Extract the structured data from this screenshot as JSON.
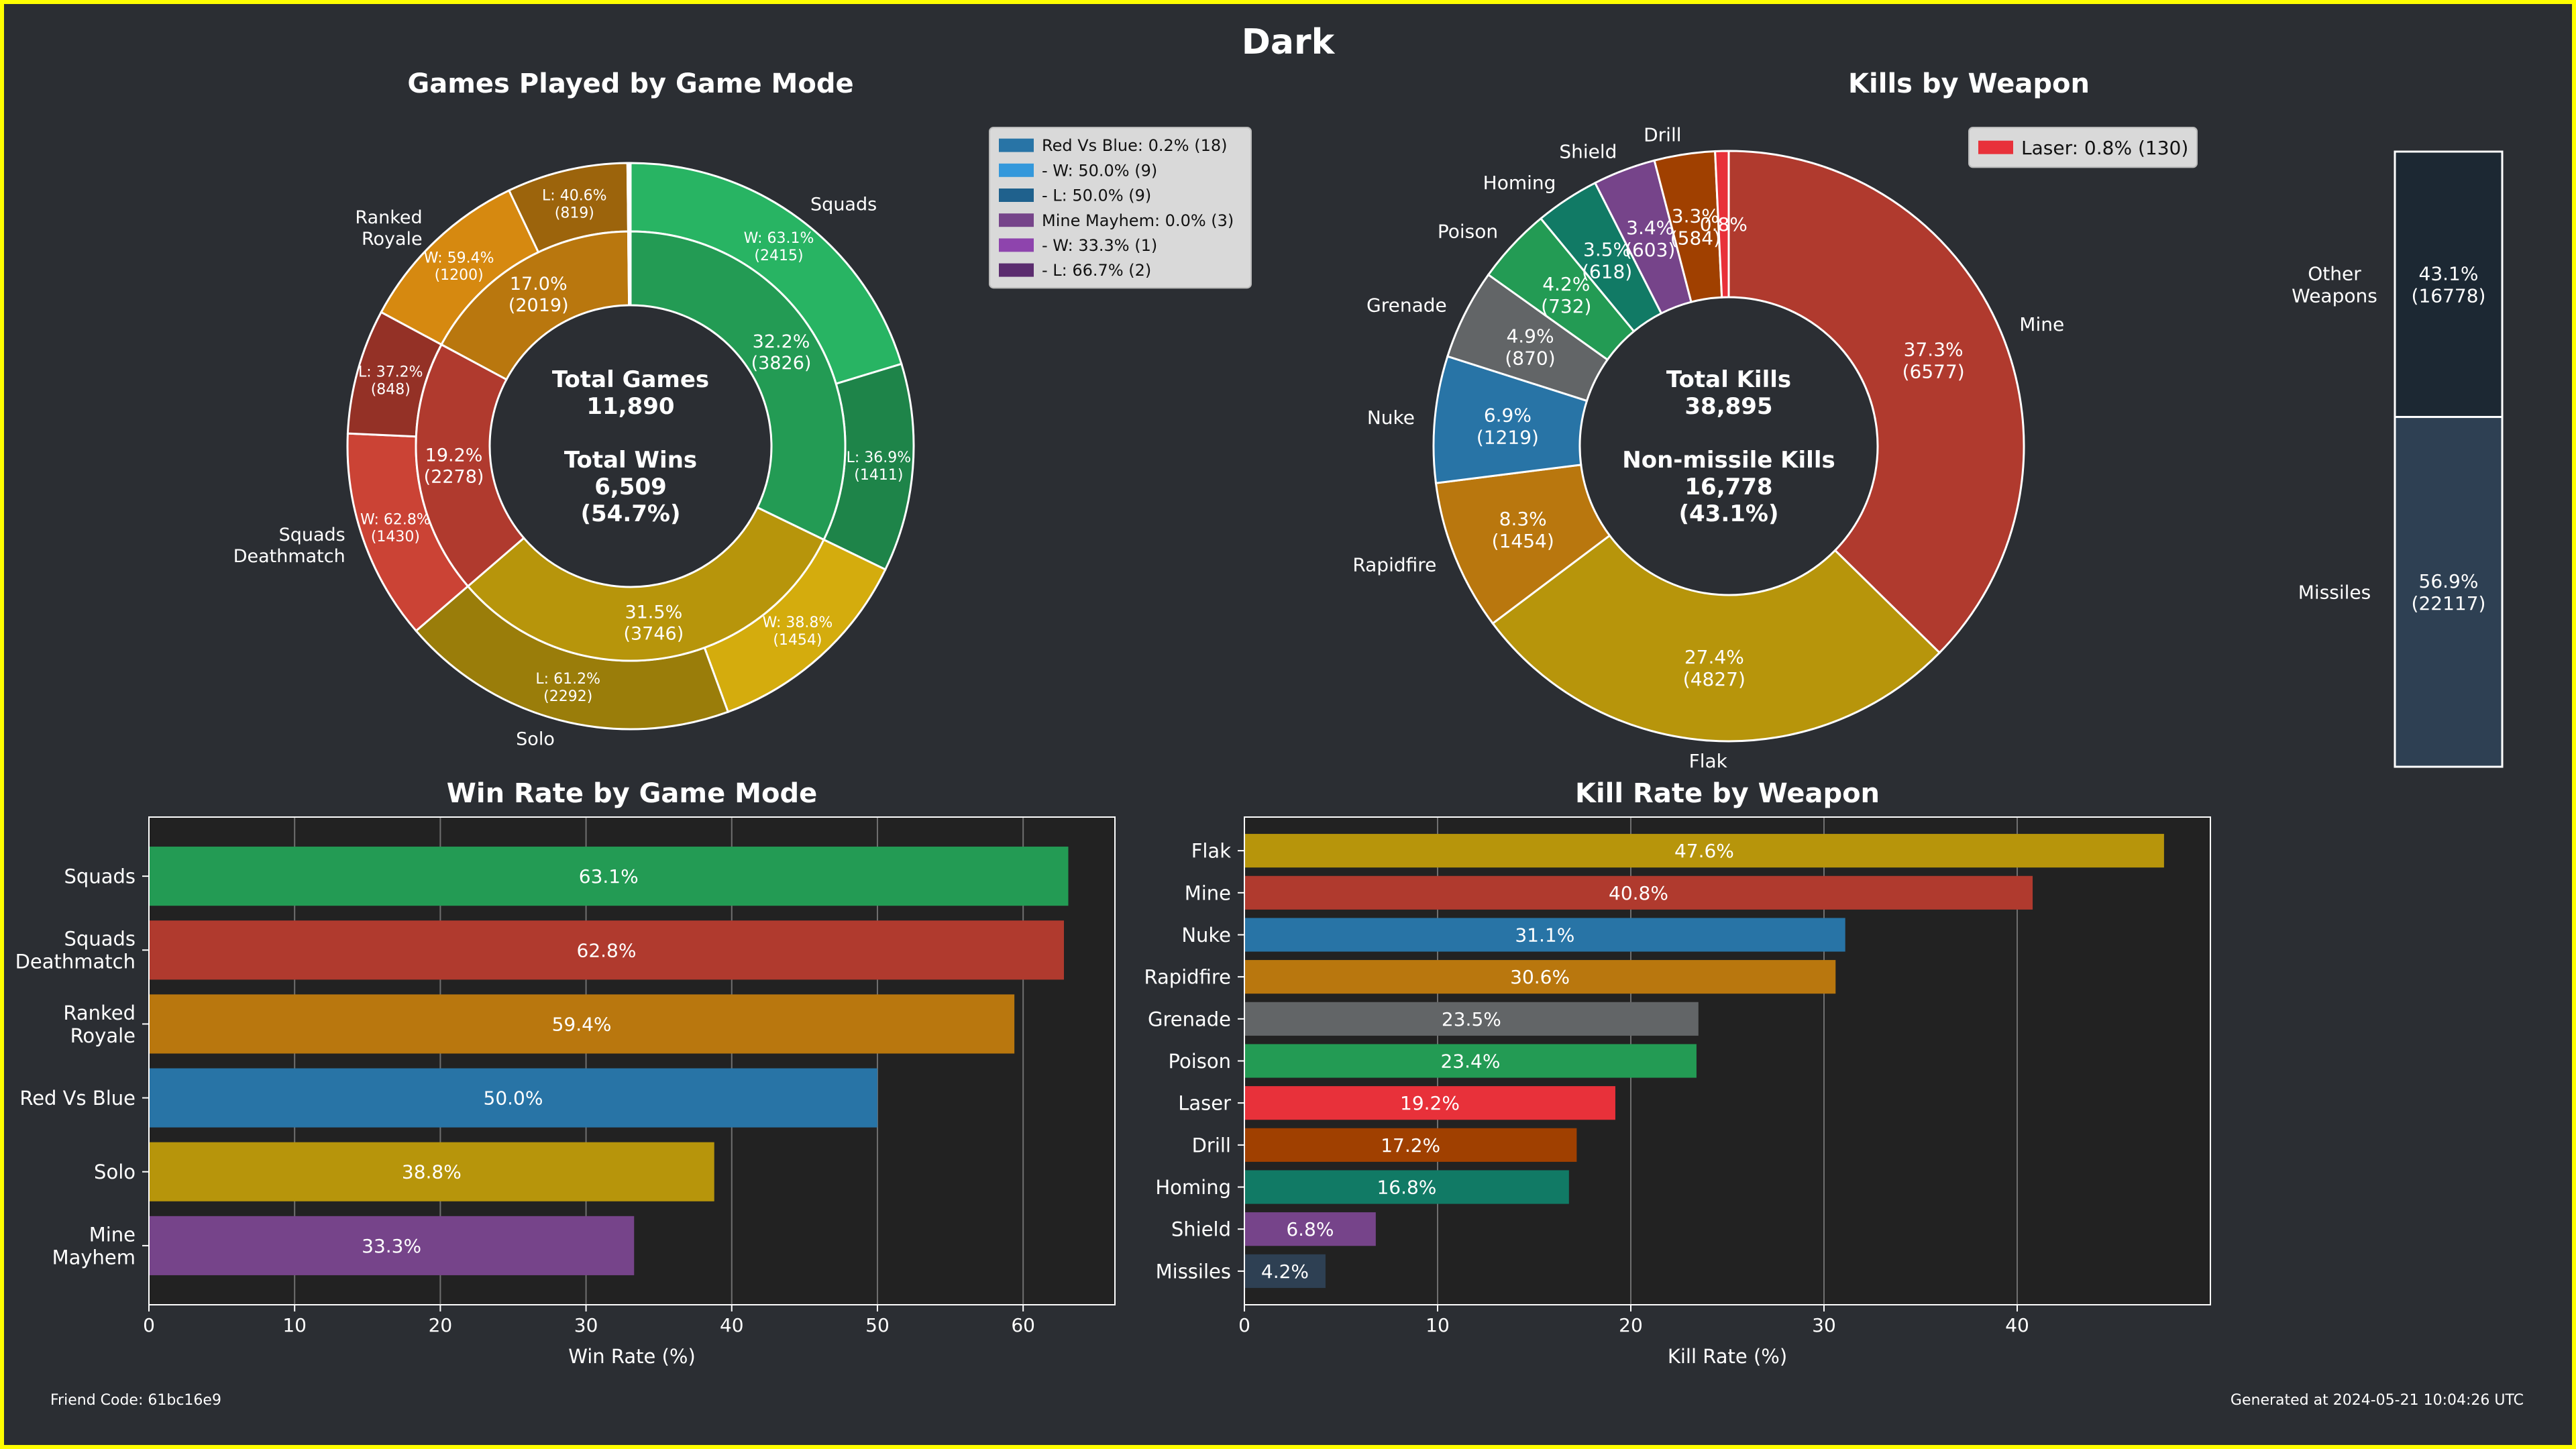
{
  "page_title": "Dark",
  "footer": {
    "friend_code": "Friend Code: 61bc16e9",
    "generated": "Generated at 2024-05-21 10:04:26 UTC"
  },
  "colors": {
    "background": "#2b2e33",
    "axes_background": "#222222",
    "border": "#ffff00"
  },
  "chart_data": [
    {
      "type": "pie",
      "subtype": "nested-donut",
      "title": "Games Played by Game Mode",
      "center_lines": [
        "Total Games",
        "11,890",
        "",
        "Total Wins",
        "6,509",
        "(54.7%)"
      ],
      "inner_ring": [
        {
          "name": "Squads",
          "value": 3826,
          "label": [
            "32.2%",
            "(3826)"
          ],
          "color": "#239b54"
        },
        {
          "name": "Solo",
          "value": 3746,
          "label": [
            "31.5%",
            "(3746)"
          ],
          "color": "#b7950b"
        },
        {
          "name": "Squads Deathmatch",
          "value": 2278,
          "label": [
            "19.2%",
            "(2278)"
          ],
          "color": "#b03a2e"
        },
        {
          "name": "Ranked Royale",
          "value": 2019,
          "label": [
            "17.0%",
            "(2019)"
          ],
          "color": "#b9770e"
        },
        {
          "name": "Red Vs Blue",
          "value": 18,
          "label": [
            "",
            ""
          ],
          "color": "#2874a6"
        },
        {
          "name": "Mine Mayhem",
          "value": 3,
          "label": [
            "",
            ""
          ],
          "color": "#76448a"
        }
      ],
      "outer_ring": [
        {
          "name": "Squads",
          "value": 2415,
          "label": [
            "W: 63.1%",
            "(2415)"
          ],
          "color": "#28b463",
          "side_label": "Squads"
        },
        {
          "name": "Squads",
          "value": 1411,
          "label": [
            "L: 36.9%",
            "(1411)"
          ],
          "color": "#1e8449",
          "side_label": ""
        },
        {
          "name": "Solo",
          "value": 1454,
          "label": [
            "W: 38.8%",
            "(1454)"
          ],
          "color": "#d4ac0d",
          "side_label": ""
        },
        {
          "name": "Solo",
          "value": 2292,
          "label": [
            "L: 61.2%",
            "(2292)"
          ],
          "color": "#9a7d0a",
          "side_label": "Solo"
        },
        {
          "name": "Squads Deathmatch",
          "value": 1430,
          "label": [
            "W: 62.8%",
            "(1430)"
          ],
          "color": "#cb4335",
          "side_label": "Squads\nDeathmatch"
        },
        {
          "name": "Squads Deathmatch",
          "value": 848,
          "label": [
            "L: 37.2%",
            "(848)"
          ],
          "color": "#943126",
          "side_label": ""
        },
        {
          "name": "Ranked Royale",
          "value": 1200,
          "label": [
            "W: 59.4%",
            "(1200)"
          ],
          "color": "#d68910",
          "side_label": "Ranked\nRoyale"
        },
        {
          "name": "Ranked Royale",
          "value": 819,
          "label": [
            "L: 40.6%",
            "(819)"
          ],
          "color": "#9c640c",
          "side_label": ""
        },
        {
          "name": "Red Vs Blue",
          "value": 9,
          "label": [
            "",
            ""
          ],
          "color": "#3498db",
          "side_label": ""
        },
        {
          "name": "Red Vs Blue",
          "value": 9,
          "label": [
            "",
            ""
          ],
          "color": "#1f618d",
          "side_label": ""
        },
        {
          "name": "Mine Mayhem",
          "value": 1,
          "label": [
            "",
            ""
          ],
          "color": "#8e44ad",
          "side_label": ""
        },
        {
          "name": "Mine Mayhem",
          "value": 2,
          "label": [
            "",
            ""
          ],
          "color": "#5b2c6f",
          "side_label": ""
        }
      ],
      "legend": [
        {
          "text": "Red Vs Blue: 0.2% (18)",
          "color": "#2874a6"
        },
        {
          "text": " - W: 50.0% (9)",
          "color": "#3498db"
        },
        {
          "text": " - L: 50.0% (9)",
          "color": "#1f618d"
        },
        {
          "text": "Mine Mayhem: 0.0% (3)",
          "color": "#76448a"
        },
        {
          "text": " - W: 33.3% (1)",
          "color": "#8e44ad"
        },
        {
          "text": " - L: 66.7% (2)",
          "color": "#5b2c6f"
        }
      ]
    },
    {
      "type": "pie",
      "subtype": "donut",
      "title": "Kills by Weapon",
      "center_lines": [
        "Total Kills",
        "38,895",
        "",
        "Non-missile Kills",
        "16,778",
        "(43.1%)"
      ],
      "slices": [
        {
          "name": "Mine",
          "value": 6577,
          "label": [
            "37.3%",
            "(6577)"
          ],
          "color": "#b03a2e",
          "side_label": "Mine"
        },
        {
          "name": "Flak",
          "value": 4827,
          "label": [
            "27.4%",
            "(4827)"
          ],
          "color": "#b7950b",
          "side_label": "Flak"
        },
        {
          "name": "Rapidfire",
          "value": 1454,
          "label": [
            "8.3%",
            "(1454)"
          ],
          "color": "#b9770e",
          "side_label": "Rapidfire"
        },
        {
          "name": "Nuke",
          "value": 1219,
          "label": [
            "6.9%",
            "(1219)"
          ],
          "color": "#2874a6",
          "side_label": "Nuke"
        },
        {
          "name": "Grenade",
          "value": 870,
          "label": [
            "4.9%",
            "(870)"
          ],
          "color": "#626567",
          "side_label": "Grenade"
        },
        {
          "name": "Poison",
          "value": 732,
          "label": [
            "4.2%",
            "(732)"
          ],
          "color": "#239b54",
          "side_label": "Poison"
        },
        {
          "name": "Homing",
          "value": 618,
          "label": [
            "3.5%",
            "(618)"
          ],
          "color": "#117a65",
          "side_label": "Homing"
        },
        {
          "name": "Shield",
          "value": 603,
          "label": [
            "3.4%",
            "(603)"
          ],
          "color": "#76448a",
          "side_label": "Shield"
        },
        {
          "name": "Drill",
          "value": 584,
          "label": [
            "3.3%",
            "(584)"
          ],
          "color": "#a04000",
          "side_label": "Drill"
        },
        {
          "name": "Laser",
          "value": 130,
          "label": [
            "0.8%",
            ""
          ],
          "color": "#e8313a",
          "side_label": ""
        }
      ],
      "legend": [
        {
          "text": "Laser: 0.8% (130)",
          "color": "#e8313a"
        }
      ],
      "side_bar": {
        "segments": [
          {
            "name": "Other\nWeapons",
            "value": 16778,
            "label": [
              "43.1%",
              "(16778)"
            ],
            "color": "#1c2833"
          },
          {
            "name": "Missiles",
            "value": 22117,
            "label": [
              "56.9%",
              "(22117)"
            ],
            "color": "#2e4053"
          }
        ]
      }
    },
    {
      "type": "bar",
      "orientation": "horizontal",
      "title": "Win Rate by Game Mode",
      "xlabel": "Win Rate (%)",
      "ylabel": "",
      "xlim": [
        0,
        66.3
      ],
      "xticks": [
        0,
        10,
        20,
        30,
        40,
        50,
        60
      ],
      "grid": true,
      "categories": [
        "Squads",
        "Squads\nDeathmatch",
        "Ranked\nRoyale",
        "Red Vs Blue",
        "Solo",
        "Mine\nMayhem"
      ],
      "values": [
        63.1,
        62.8,
        59.4,
        50.0,
        38.8,
        33.3
      ],
      "value_labels": [
        "63.1%",
        "62.8%",
        "59.4%",
        "50.0%",
        "38.8%",
        "33.3%"
      ],
      "colors": [
        "#239b54",
        "#b03a2e",
        "#b9770e",
        "#2874a6",
        "#b7950b",
        "#76448a"
      ]
    },
    {
      "type": "bar",
      "orientation": "horizontal",
      "title": "Kill Rate by Weapon",
      "xlabel": "Kill Rate (%)",
      "ylabel": "",
      "xlim": [
        0,
        50.0
      ],
      "xticks": [
        0,
        10,
        20,
        30,
        40
      ],
      "grid": true,
      "categories": [
        "Flak",
        "Mine",
        "Nuke",
        "Rapidfire",
        "Grenade",
        "Poison",
        "Laser",
        "Drill",
        "Homing",
        "Shield",
        "Missiles"
      ],
      "values": [
        47.6,
        40.8,
        31.1,
        30.6,
        23.5,
        23.4,
        19.2,
        17.2,
        16.8,
        6.8,
        4.2
      ],
      "value_labels": [
        "47.6%",
        "40.8%",
        "31.1%",
        "30.6%",
        "23.5%",
        "23.4%",
        "19.2%",
        "17.2%",
        "16.8%",
        "6.8%",
        "4.2%"
      ],
      "colors": [
        "#b7950b",
        "#b03a2e",
        "#2874a6",
        "#b9770e",
        "#626567",
        "#239b54",
        "#e8313a",
        "#a04000",
        "#117a65",
        "#76448a",
        "#2e4053"
      ]
    }
  ]
}
